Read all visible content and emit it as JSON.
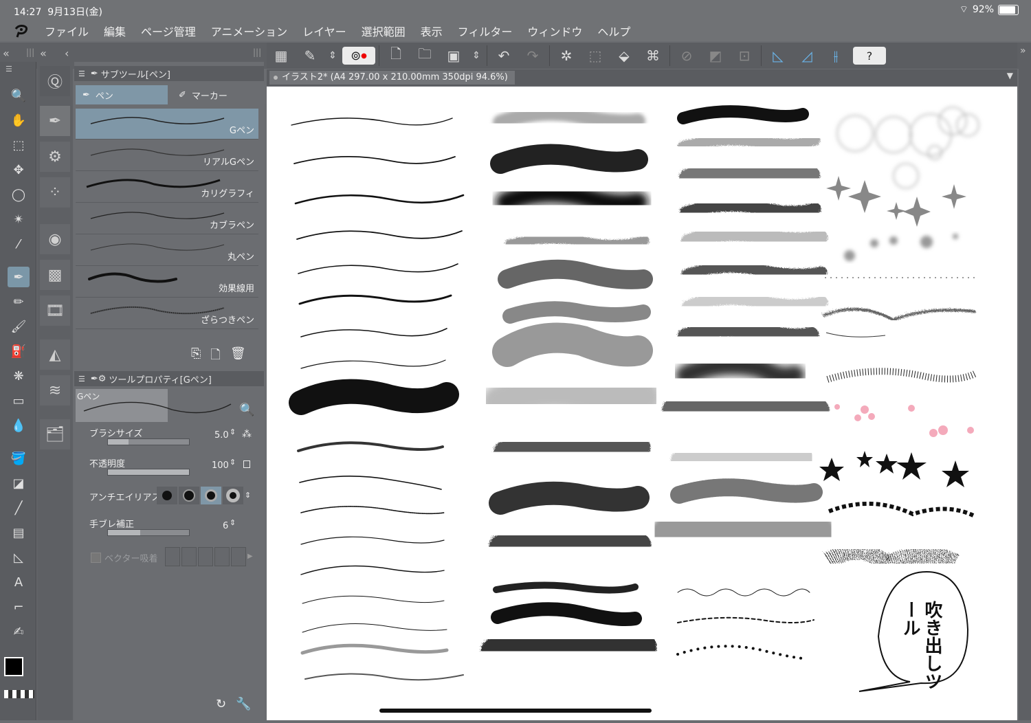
{
  "status": {
    "time": "14:27",
    "date": "9月13日(金)",
    "battery": "92%"
  },
  "menu": [
    "ファイル",
    "編集",
    "ページ管理",
    "アニメーション",
    "レイヤー",
    "選択範囲",
    "表示",
    "フィルター",
    "ウィンドウ",
    "ヘルプ"
  ],
  "document": {
    "tab_title": "イラスト2* (A4 297.00 x 210.00mm 350dpi 94.6%)"
  },
  "subtool_panel": {
    "title": "サブツール[ペン]",
    "tabs": [
      "ペン",
      "マーカー"
    ],
    "brushes": [
      "Gペン",
      "リアルGペン",
      "カリグラフィ",
      "カブラペン",
      "丸ペン",
      "効果線用",
      "ざらつきペン"
    ],
    "selected": 0
  },
  "tool_property": {
    "title": "ツールプロパティ[Gペン]",
    "preview_label": "Gペン",
    "brush_size": {
      "label": "ブラシサイズ",
      "value": "5.0",
      "level": 0.25
    },
    "opacity": {
      "label": "不透明度",
      "value": "100",
      "level": 1.0
    },
    "antialias": {
      "label": "アンチエイリアス"
    },
    "stabilization": {
      "label": "手ブレ補正",
      "value": "6",
      "level": 0.4
    },
    "vector_snap": {
      "label": "ベクター吸着"
    }
  },
  "speech_bubble": {
    "text": "吹き出しツール"
  },
  "colors": {
    "accent": "#7f97a7",
    "panel": "#6b6d71",
    "bg": "#5e6064"
  }
}
